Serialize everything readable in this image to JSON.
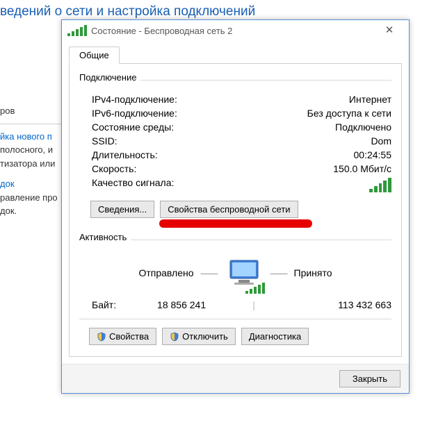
{
  "bg": {
    "header": "ведений о сети и настройка подключений",
    "left1": "ров",
    "left2_link": "йка нового п",
    "left3": "полосного, и",
    "left4": "тизатора или",
    "left5_link": "док",
    "left6": "равление про",
    "left7": "док."
  },
  "dialog": {
    "title": "Состояние - Беспроводная сеть 2",
    "tab_general": "Общие",
    "connection": {
      "group": "Подключение",
      "ipv4_l": "IPv4-подключение:",
      "ipv4_v": "Интернет",
      "ipv6_l": "IPv6-подключение:",
      "ipv6_v": "Без доступа к сети",
      "media_l": "Состояние среды:",
      "media_v": "Подключено",
      "ssid_l": "SSID:",
      "ssid_v": "Dom",
      "dur_l": "Длительность:",
      "dur_v": "00:24:55",
      "speed_l": "Скорость:",
      "speed_v": "150.0 Мбит/с",
      "sigq_l": "Качество сигнала:"
    },
    "buttons": {
      "details": "Сведения...",
      "wprops": "Свойства беспроводной сети"
    },
    "activity": {
      "group": "Активность",
      "sent": "Отправлено",
      "recv": "Принято",
      "bytes_l": "Байт:",
      "bytes_sent": "18 856 241",
      "bytes_recv": "113 432 663"
    },
    "bottom": {
      "props": "Свойства",
      "disable": "Отключить",
      "diag": "Диагностика"
    },
    "close": "Закрыть"
  }
}
